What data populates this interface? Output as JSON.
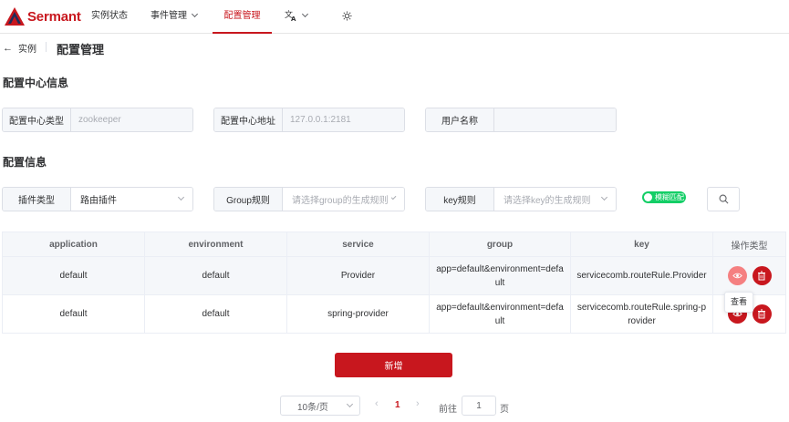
{
  "header": {
    "brand": "Sermant",
    "nav": [
      {
        "label": "实例状态"
      },
      {
        "label": "事件管理"
      },
      {
        "label": "配置管理"
      }
    ],
    "lang_icon": "translate-icon",
    "theme_icon": "sun-icon"
  },
  "breadcrumb": {
    "back_label": "实例",
    "title": "配置管理"
  },
  "config_center": {
    "title": "配置中心信息",
    "type_label": "配置中心类型",
    "type_value": "zookeeper",
    "address_label": "配置中心地址",
    "address_value": "127.0.0.1:2181",
    "user_label": "用户名称",
    "user_value": ""
  },
  "config_info": {
    "title": "配置信息",
    "plugin_label": "插件类型",
    "plugin_value": "路由插件",
    "group_label": "Group规则",
    "group_placeholder": "请选择group的生成规则",
    "key_label": "key规则",
    "key_placeholder": "请选择key的生成规则",
    "toggle_label": "模糊匹配",
    "toggle_on": true
  },
  "table": {
    "columns": [
      "application",
      "environment",
      "service",
      "group",
      "key",
      "操作类型"
    ],
    "rows": [
      {
        "application": "default",
        "environment": "default",
        "service": "Provider",
        "group": "app=default&environment=default",
        "key": "servicecomb.routeRule.Provider"
      },
      {
        "application": "default",
        "environment": "default",
        "service": "spring-provider",
        "group": "app=default&environment=default",
        "key": "servicecomb.routeRule.spring-provider"
      }
    ],
    "tooltip": "查看"
  },
  "add_button": "新增",
  "pagination": {
    "page_size": "10条/页",
    "current_page": "1",
    "goto_label": "前往",
    "goto_value": "1",
    "page_unit": "页"
  },
  "colors": {
    "brand": "#c8171e",
    "toggle": "#13ce66"
  }
}
